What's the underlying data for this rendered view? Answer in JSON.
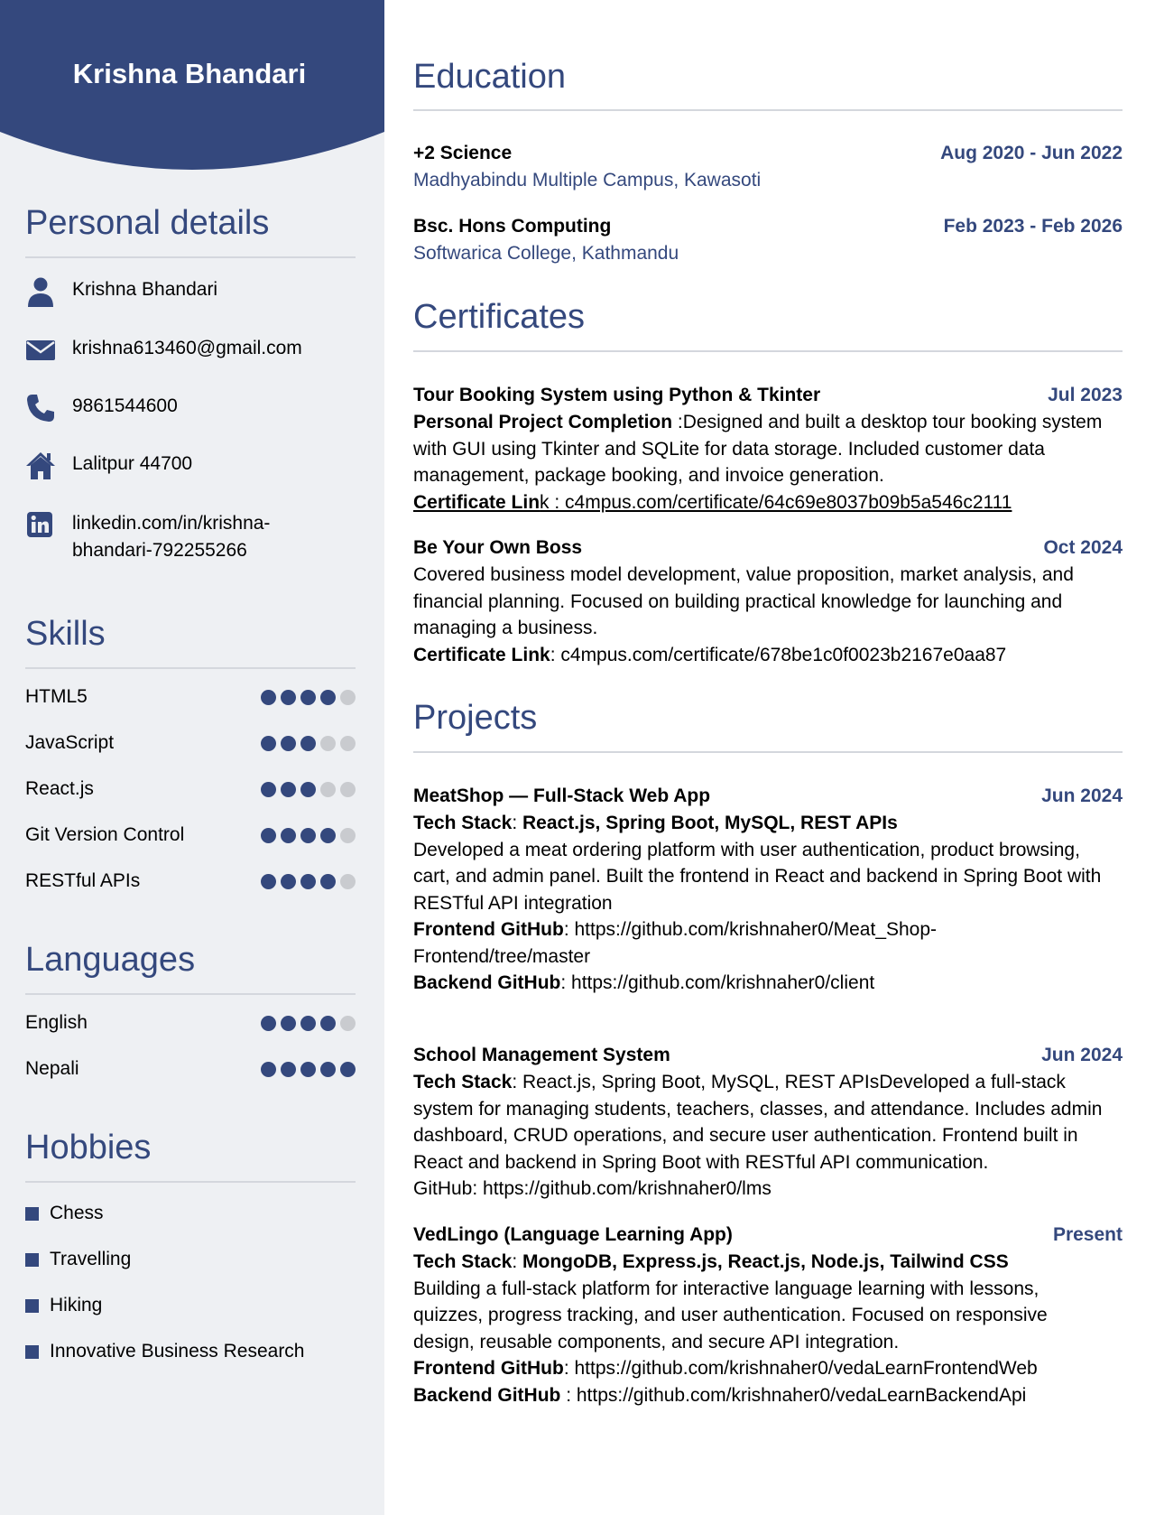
{
  "header": {
    "name": "Krishna Bhandari"
  },
  "colors": {
    "accent": "#34487d",
    "sidebar_bg": "#eef0f3",
    "dot_off": "#c9cbcf"
  },
  "personal": {
    "title": "Personal details",
    "items": [
      {
        "icon": "person-icon",
        "text": "Krishna Bhandari"
      },
      {
        "icon": "envelope-icon",
        "text": "krishna613460@gmail.com"
      },
      {
        "icon": "phone-icon",
        "text": "9861544600"
      },
      {
        "icon": "home-icon",
        "text": "Lalitpur 44700"
      },
      {
        "icon": "linkedin-icon",
        "text_line1": "linkedin.com/in/krishna-",
        "text_line2": "bhandari-792255266"
      }
    ]
  },
  "skills": {
    "title": "Skills",
    "items": [
      {
        "name": "HTML5",
        "level": 4,
        "max": 5
      },
      {
        "name": "JavaScript",
        "level": 3,
        "max": 5
      },
      {
        "name": "React.js",
        "level": 3,
        "max": 5
      },
      {
        "name": "Git Version Control",
        "level": 4,
        "max": 5
      },
      {
        "name": "RESTful APIs",
        "level": 4,
        "max": 5
      }
    ]
  },
  "languages": {
    "title": "Languages",
    "items": [
      {
        "name": "English",
        "level": 4,
        "max": 5
      },
      {
        "name": "Nepali",
        "level": 5,
        "max": 5
      }
    ]
  },
  "hobbies": {
    "title": "Hobbies",
    "items": [
      "Chess",
      "Travelling",
      "Hiking",
      "Innovative Business Research"
    ]
  },
  "education": {
    "title": "Education",
    "items": [
      {
        "degree": "+2 Science",
        "date": "Aug 2020 - Jun 2022",
        "school": "Madhyabindu Multiple Campus, Kawasoti"
      },
      {
        "degree": "Bsc. Hons Computing",
        "date": "Feb 2023 - Feb 2026",
        "school": "Softwarica College, Kathmandu"
      }
    ]
  },
  "certificates": {
    "title": "Certificates",
    "items": [
      {
        "name": "Tour Booking System using Python & Tkinter",
        "date": "Jul 2023",
        "bold_lead": "Personal Project Completion",
        "lead_rest": " :Designed and built a desktop tour booking system",
        "line2": "with GUI using Tkinter and SQLite for data storage. Included customer data",
        "line3": "management, package booking, and invoice generation.",
        "link_label_bold": "Certificate Lin",
        "link_rest": "k : c4mpus.com/certificate/64c69e8037b09b5a546c2111"
      },
      {
        "name": "Be Your Own Boss",
        "date": "Oct 2024",
        "line1": "Covered business model development, value proposition, market analysis, and",
        "line2": "financial planning. Focused on building practical knowledge for launching and",
        "line3": "managing a business.",
        "link_label": "Certificate Link",
        "link_rest": ": c4mpus.com/certificate/678be1c0f0023b2167e0aa87"
      }
    ]
  },
  "projects": {
    "title": "Projects",
    "items": [
      {
        "name": "MeatShop — Full-Stack Web App",
        "date": "Jun 2024",
        "stack_label": "Tech Stack",
        "stack_sep": ": ",
        "stack": "React.js, Spring Boot, MySQL, REST APIs",
        "line1": "Developed a meat ordering platform with user authentication, product browsing,",
        "line2": "cart, and admin panel. Built the frontend in React and backend in Spring Boot with",
        "line3": "RESTful API integration",
        "fe_label": "Frontend GitHub",
        "fe_line1": ": https://github.com/krishnaher0/Meat_Shop-",
        "fe_line2": "Frontend/tree/master",
        "be_label": "Backend GitHub",
        "be_rest": ": https://github.com/krishnaher0/client"
      },
      {
        "name": "School Management System",
        "date": "Jun 2024",
        "stack_label": "Tech Stack",
        "line1_rest": ": React.js, Spring Boot, MySQL, REST APIsDeveloped a full-stack",
        "line2": "system for managing students, teachers, classes, and attendance. Includes admin",
        "line3": "dashboard, CRUD operations, and secure user authentication. Frontend built in",
        "line4": "React and backend in Spring Boot with RESTful API communication.",
        "line5": "GitHub: https://github.com/krishnaher0/lms"
      },
      {
        "name": "VedLingo (Language Learning App)",
        "date": "Present",
        "stack_label": "Tech Stack",
        "stack_sep": ": ",
        "stack": "MongoDB, Express.js, React.js, Node.js, Tailwind CSS",
        "line1": "Building a full-stack platform for interactive language learning with lessons,",
        "line2": "quizzes, progress tracking, and user authentication. Focused on responsive",
        "line3": "design, reusable components, and secure API integration.",
        "fe_label": "Frontend GitHub",
        "fe_rest": ": https://github.com/krishnaher0/vedaLearnFrontendWeb",
        "be_label": "Backend GitHub",
        "be_rest": " : https://github.com/krishnaher0/vedaLearnBackendApi"
      }
    ]
  }
}
